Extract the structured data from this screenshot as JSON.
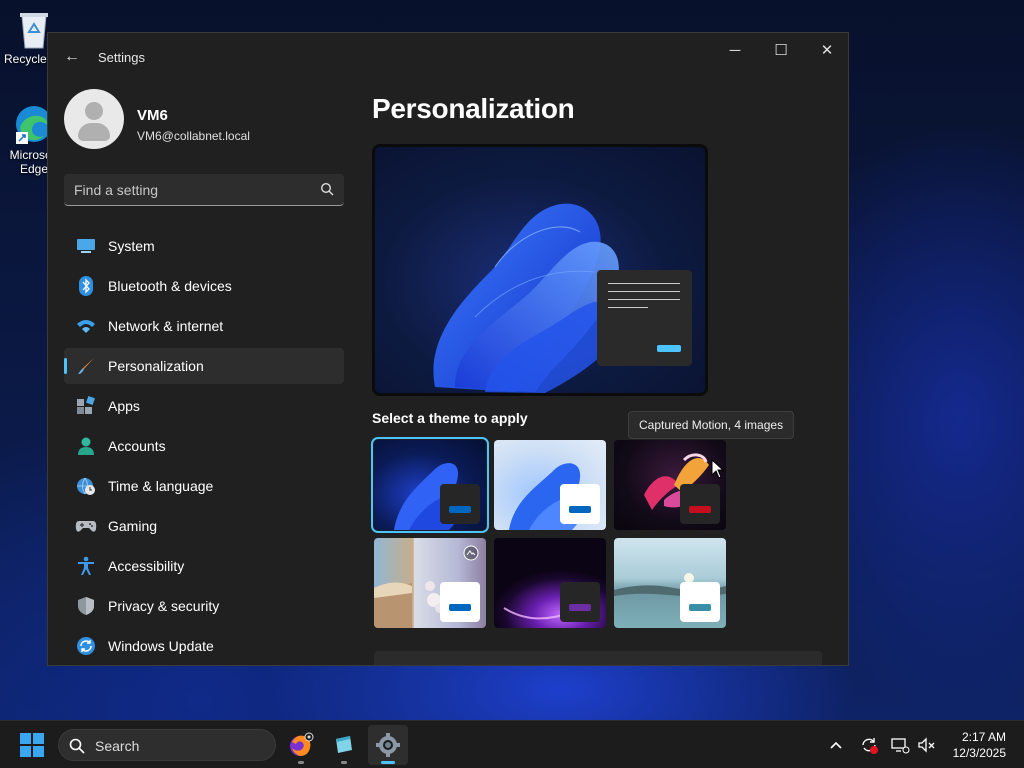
{
  "desktop": {
    "icons": [
      {
        "label": "Recycle Bin"
      },
      {
        "label": "Microsoft Edge"
      }
    ]
  },
  "window": {
    "title": "Settings",
    "controls": {
      "minimize": "─",
      "maximize": "☐",
      "close": "✕"
    }
  },
  "profile": {
    "name": "VM6",
    "email": "VM6@collabnet.local"
  },
  "search": {
    "placeholder": "Find a setting"
  },
  "nav": [
    {
      "label": "System",
      "icon": "system-icon"
    },
    {
      "label": "Bluetooth & devices",
      "icon": "bluetooth-icon"
    },
    {
      "label": "Network & internet",
      "icon": "wifi-icon"
    },
    {
      "label": "Personalization",
      "icon": "brush-icon",
      "active": true
    },
    {
      "label": "Apps",
      "icon": "apps-icon"
    },
    {
      "label": "Accounts",
      "icon": "accounts-icon"
    },
    {
      "label": "Time & language",
      "icon": "globe-clock-icon"
    },
    {
      "label": "Gaming",
      "icon": "gamepad-icon"
    },
    {
      "label": "Accessibility",
      "icon": "accessibility-icon"
    },
    {
      "label": "Privacy & security",
      "icon": "shield-icon"
    },
    {
      "label": "Windows Update",
      "icon": "update-icon"
    }
  ],
  "main": {
    "title": "Personalization",
    "section_title": "Select a theme to apply",
    "tooltip": "Captured Motion, 4 images",
    "themes": [
      {
        "name": "windows-dark",
        "selected": true,
        "accent": "#0067c0",
        "tile": "#262626"
      },
      {
        "name": "windows-light",
        "accent": "#0067c0",
        "tile": "#ffffff"
      },
      {
        "name": "captured-motion",
        "accent": "#c50f1f",
        "tile": "#262626"
      },
      {
        "name": "spotlight",
        "accent": "#0067c0",
        "tile": "#ffffff"
      },
      {
        "name": "glow",
        "accent": "#6b2fa3",
        "tile": "#262626"
      },
      {
        "name": "sunrise",
        "accent": "#3a8fa8",
        "tile": "#ffffff"
      }
    ]
  },
  "taskbar": {
    "search_label": "Search",
    "time": "2:17 AM",
    "date": "12/3/2025",
    "apps": [
      "firefox-icon",
      "app-icon",
      "settings-gear-icon"
    ]
  },
  "colors": {
    "accent": "#4cc2ff",
    "window_bg": "#202020"
  }
}
